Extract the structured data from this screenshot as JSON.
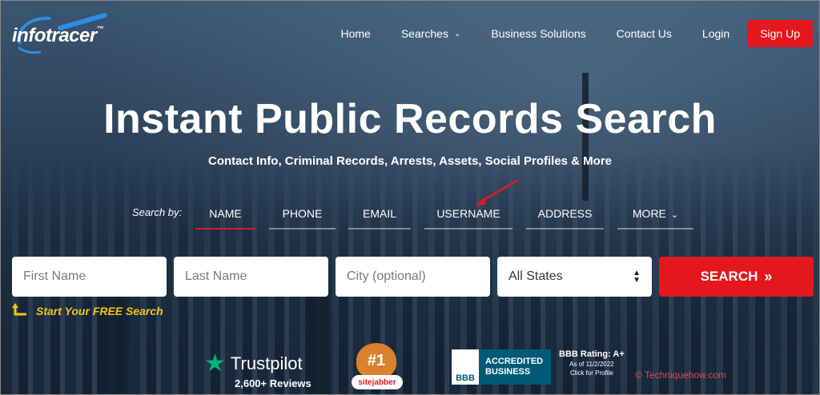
{
  "header": {
    "logo_text": "infotracer",
    "logo_tm": "™",
    "nav": [
      {
        "label": "Home"
      },
      {
        "label": "Searches"
      },
      {
        "label": "Business Solutions"
      },
      {
        "label": "Contact Us"
      },
      {
        "label": "Login"
      }
    ],
    "signup_label": "Sign Up"
  },
  "hero": {
    "title": "Instant Public Records Search",
    "subtitle": "Contact Info, Criminal Records, Arrests, Assets, Social Profiles & More"
  },
  "search": {
    "search_by_label": "Search by:",
    "tabs": [
      "NAME",
      "PHONE",
      "EMAIL",
      "USERNAME",
      "ADDRESS",
      "MORE"
    ],
    "active_tab": "NAME",
    "first_name_placeholder": "First Name",
    "last_name_placeholder": "Last Name",
    "city_placeholder": "City (optional)",
    "state_selected": "All States",
    "button_label": "SEARCH",
    "free_search_label": "Start Your FREE Search"
  },
  "badges": {
    "trustpilot_name": "Trustpilot",
    "trustpilot_reviews": "2,600+ Reviews",
    "sitejabber_rank": "#1",
    "sitejabber_name": "sitejabber",
    "bbb_logo": "BBB",
    "bbb_line1": "ACCREDITED",
    "bbb_line2": "BUSINESS",
    "bbb_rating": "BBB Rating: A+",
    "bbb_asof": "As of 11/2/2022",
    "bbb_click": "Click for Profile"
  },
  "watermark": "© Techniquehow.com",
  "colors": {
    "accent_red": "#e4171d",
    "free_search_yellow": "#f5c518",
    "trustpilot_green": "#00b67a",
    "bbb_blue": "#005a78"
  }
}
